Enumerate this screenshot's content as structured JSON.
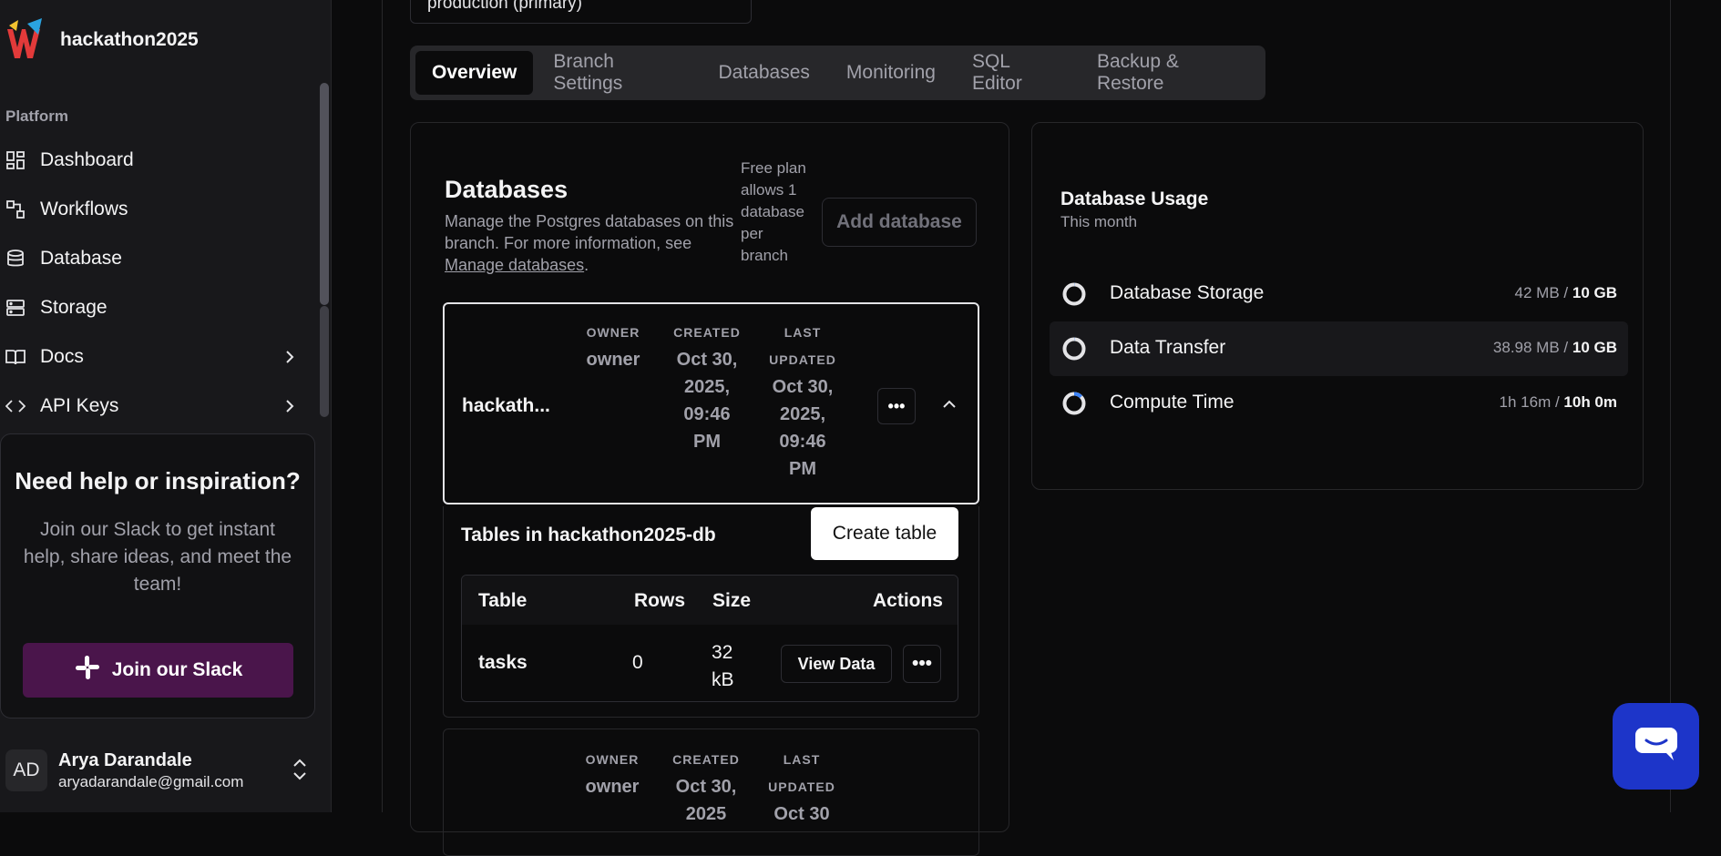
{
  "sidebar": {
    "org_name": "hackathon2025",
    "section_label": "Platform",
    "items": [
      {
        "label": "Dashboard",
        "icon": "grid-icon"
      },
      {
        "label": "Workflows",
        "icon": "workflow-icon"
      },
      {
        "label": "Database",
        "icon": "database-icon"
      },
      {
        "label": "Storage",
        "icon": "storage-icon"
      },
      {
        "label": "Docs",
        "icon": "book-icon"
      },
      {
        "label": "API Keys",
        "icon": "code-icon"
      }
    ],
    "help": {
      "title": "Need help or inspiration?",
      "body": "Join our Slack to get instant help, share ideas, and meet the team!",
      "button": "Join our Slack"
    },
    "user": {
      "initials": "AD",
      "name": "Arya Darandale",
      "email": "aryadarandale@gmail.com"
    }
  },
  "branch_selector": {
    "value": "production (primary)"
  },
  "tabs": [
    "Overview",
    "Branch Settings",
    "Databases",
    "Monitoring",
    "SQL Editor",
    "Backup & Restore"
  ],
  "databases_card": {
    "title": "Databases",
    "desc_prefix": "Manage the Postgres databases on this branch. For more information, see ",
    "desc_link": "Manage databases",
    "desc_suffix": ".",
    "free_note": "Free plan allows 1 database per branch",
    "add_button": "Add database",
    "db": {
      "name": "hackath...",
      "owner_header": "OWNER",
      "owner": "owner",
      "created_header": "CREATED",
      "created": "Oct 30, 2025, 09:46 PM",
      "updated_header": "LAST UPDATED",
      "updated": "Oct 30, 2025, 09:46 PM"
    },
    "tables_title": "Tables in hackathon2025-db",
    "create_table": "Create table",
    "table_headers": [
      "Table",
      "Rows",
      "Size",
      "Actions"
    ],
    "table_rows": [
      {
        "name": "tasks",
        "rows": "0",
        "size": "32 kB",
        "action": "View Data"
      }
    ],
    "db2": {
      "owner_header": "OWNER",
      "owner": "owner",
      "created_header": "CREATED",
      "created": "Oct 30, 2025",
      "updated_header": "LAST UPDATED",
      "updated": "Oct 30"
    }
  },
  "usage": {
    "title": "Database Usage",
    "subtitle": "This month",
    "items": [
      {
        "label": "Database Storage",
        "used": "42 MB",
        "limit": "10 GB",
        "fraction": 0.004
      },
      {
        "label": "Data Transfer",
        "used": "38.98 MB",
        "limit": "10 GB",
        "fraction": 0.004
      },
      {
        "label": "Compute Time",
        "used": "1h 16m",
        "limit": "10h 0m",
        "fraction": 0.127
      }
    ]
  },
  "colors": {
    "accent_purple": "#4a154b",
    "chat_blue": "#1d35c9",
    "ring_progress": "#3b82f6"
  }
}
